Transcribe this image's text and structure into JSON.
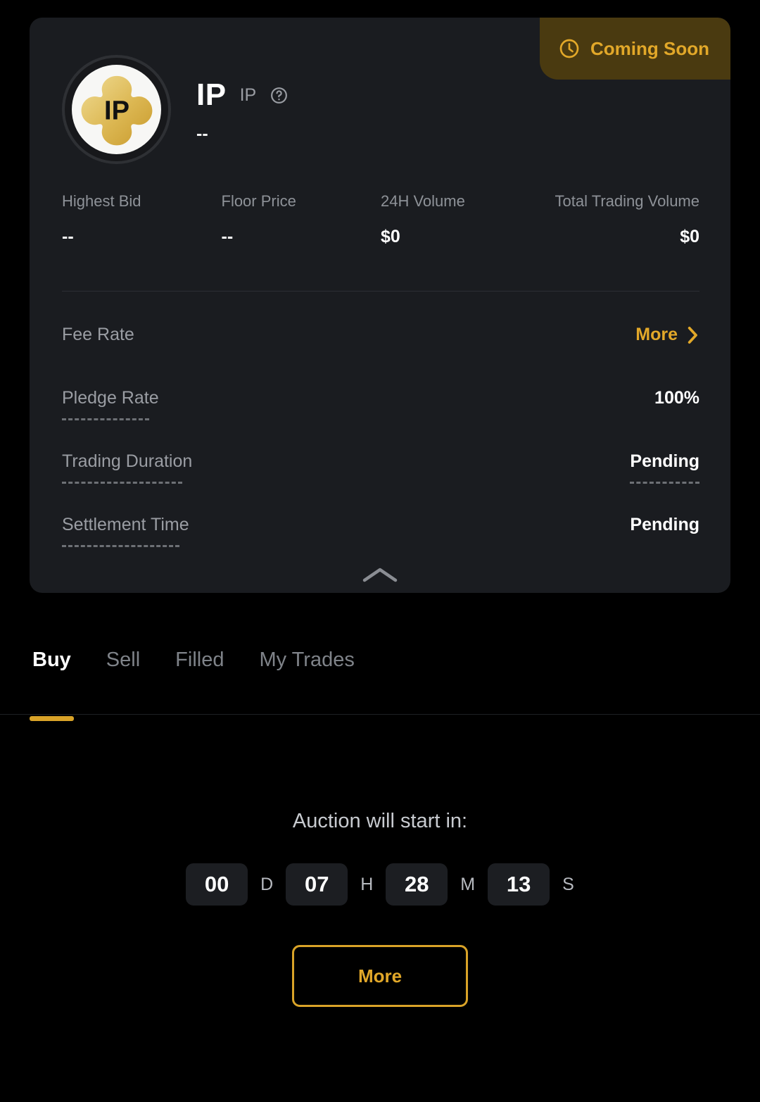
{
  "theme": {
    "page_bg": "#000000",
    "card_bg": "#1a1c20",
    "accent": "#d9a328",
    "accent_text": "#e2a829",
    "badge_bg": "#4a3a10",
    "muted_text": "#9a9da3",
    "value_text": "#ffffff"
  },
  "badge": {
    "label": "Coming Soon",
    "icon": "clock-icon"
  },
  "token": {
    "logo_text": "IP",
    "symbol": "IP",
    "sub_symbol": "IP",
    "help_icon": "question-circle-icon",
    "price": "--"
  },
  "stats": [
    {
      "label": "Highest Bid",
      "value": "--",
      "align": "left"
    },
    {
      "label": "Floor Price",
      "value": "--",
      "align": "left"
    },
    {
      "label": "24H Volume",
      "value": "$0",
      "align": "left"
    },
    {
      "label": "Total Trading Volume",
      "value": "$0",
      "align": "right"
    }
  ],
  "details": [
    {
      "label": "Fee Rate",
      "value": "More",
      "type": "link",
      "label_dotted": false,
      "value_dotted": false,
      "icon": "chevron-right-icon"
    },
    {
      "label": "Pledge Rate",
      "value": "100%",
      "type": "text",
      "label_dotted": true,
      "value_dotted": false
    },
    {
      "label": "Trading Duration",
      "value": "Pending",
      "type": "text",
      "label_dotted": true,
      "value_dotted": true
    },
    {
      "label": "Settlement Time",
      "value": "Pending",
      "type": "text",
      "label_dotted": true,
      "value_dotted": false
    }
  ],
  "collapse": {
    "icon": "chevron-up-icon"
  },
  "tabs": [
    {
      "label": "Buy",
      "active": true
    },
    {
      "label": "Sell",
      "active": false
    },
    {
      "label": "Filled",
      "active": false
    },
    {
      "label": "My Trades",
      "active": false
    }
  ],
  "countdown": {
    "title": "Auction will start in:",
    "units": [
      {
        "value": "00",
        "unit": "D"
      },
      {
        "value": "07",
        "unit": "H"
      },
      {
        "value": "28",
        "unit": "M"
      },
      {
        "value": "13",
        "unit": "S"
      }
    ]
  },
  "footer": {
    "more_button": "More"
  }
}
